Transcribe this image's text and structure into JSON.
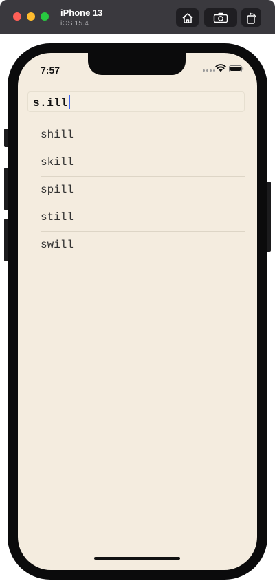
{
  "simulator": {
    "device_name": "iPhone 13",
    "os_version": "iOS 15.4",
    "buttons": [
      {
        "name": "home",
        "icon": "home-icon"
      },
      {
        "name": "screenshot",
        "icon": "camera-icon"
      },
      {
        "name": "rotate",
        "icon": "rotate-icon"
      }
    ]
  },
  "status_bar": {
    "time": "7:57",
    "icons": [
      "cellular-icon",
      "wifi-icon",
      "battery-icon"
    ]
  },
  "search": {
    "value": "s.ill"
  },
  "results": [
    {
      "word": "shill"
    },
    {
      "word": "skill"
    },
    {
      "word": "spill"
    },
    {
      "word": "still"
    },
    {
      "word": "swill"
    }
  ],
  "colors": {
    "background": "#f4ecdf",
    "caret": "#3c64f0",
    "toolbar": "#3a393e"
  }
}
